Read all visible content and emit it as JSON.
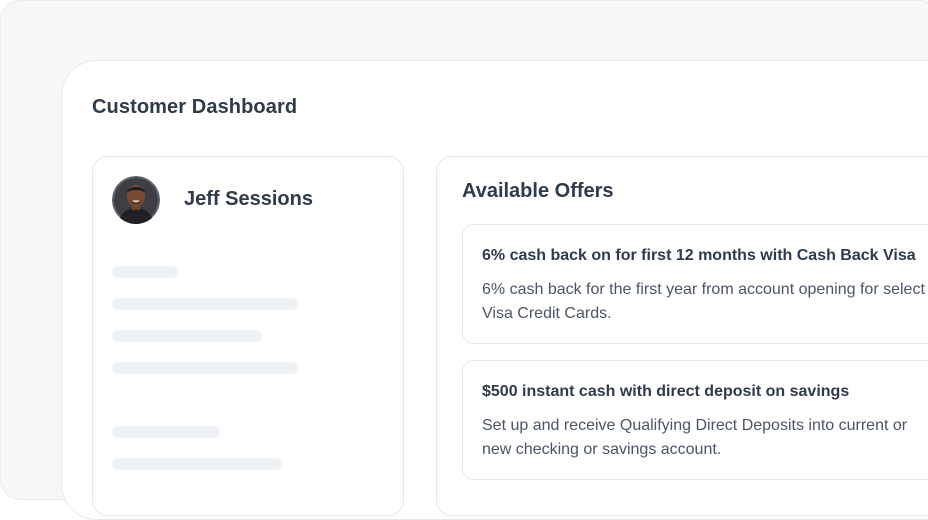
{
  "dashboard": {
    "title": "Customer Dashboard"
  },
  "profile": {
    "name": "Jeff Sessions",
    "avatar_icon": "person-avatar"
  },
  "offers": {
    "title": "Available Offers",
    "items": [
      {
        "heading": "6% cash back on for first 12 months with Cash Back Visa",
        "description": "6% cash back for the first year from account opening for select Visa Credit Cards."
      },
      {
        "heading": "$500 instant cash with direct deposit on savings",
        "description": "Set up and receive Qualifying Direct Deposits into current or new checking or savings account."
      }
    ]
  },
  "colors": {
    "text_primary": "#2f3a4a",
    "text_secondary": "#4b5563",
    "skeleton": "#eef2f7",
    "border": "#e7e8ea",
    "outer_background": "#f7f7f7"
  }
}
